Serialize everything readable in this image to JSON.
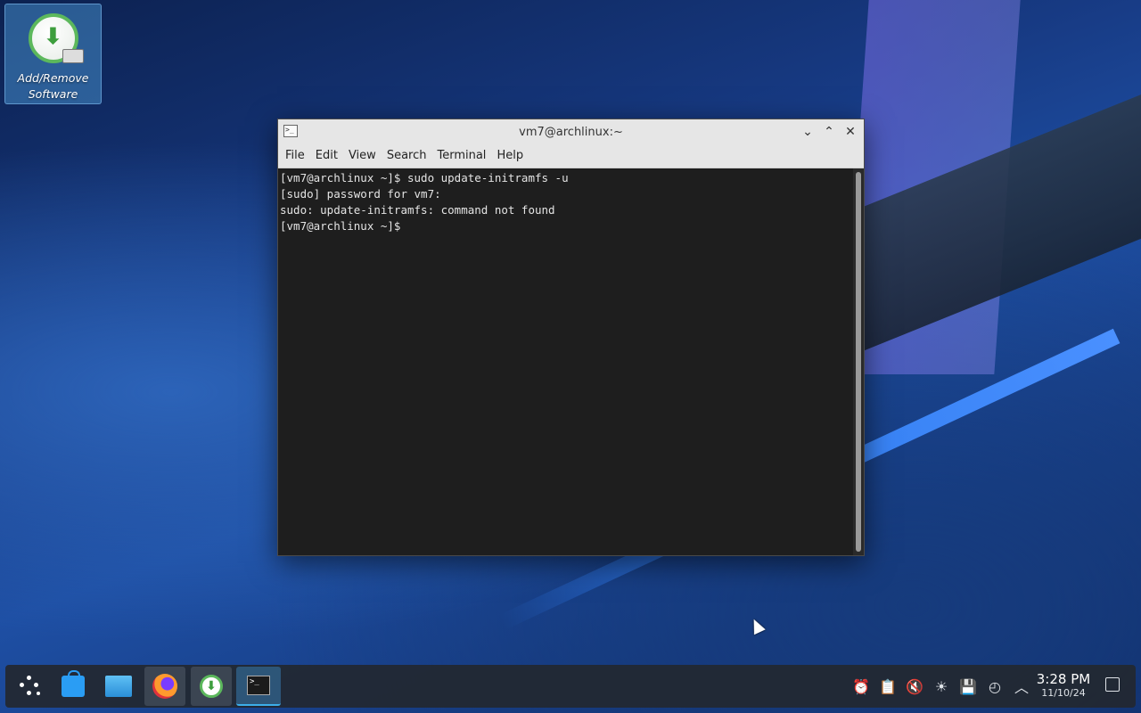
{
  "desktop": {
    "icons": [
      {
        "label_line1": "Add/Remove",
        "label_line2": "Software",
        "icon": "package-install-icon"
      }
    ]
  },
  "window": {
    "title": "vm7@archlinux:~",
    "app_icon": "terminal-icon",
    "controls": {
      "minimize": "minimize-icon",
      "maximize": "maximize-icon",
      "close": "close-icon"
    },
    "menu": [
      "File",
      "Edit",
      "View",
      "Search",
      "Terminal",
      "Help"
    ],
    "terminal_lines": [
      "[vm7@archlinux ~]$ sudo update-initramfs -u",
      "[sudo] password for vm7:",
      "sudo: update-initramfs: command not found",
      "[vm7@archlinux ~]$ "
    ]
  },
  "taskbar": {
    "launchers": [
      {
        "name": "application-launcher",
        "icon": "launcher-icon"
      },
      {
        "name": "discover",
        "icon": "store-icon"
      },
      {
        "name": "file-manager",
        "icon": "folder-icon"
      },
      {
        "name": "firefox",
        "icon": "firefox-icon"
      },
      {
        "name": "software-installer",
        "icon": "download-icon"
      },
      {
        "name": "konsole",
        "icon": "terminal-icon"
      }
    ],
    "tray": [
      "notifications-icon",
      "clipboard-icon",
      "volume-muted-icon",
      "brightness-icon",
      "save-icon",
      "update-icon",
      "expand-tray-icon"
    ],
    "clock": {
      "time": "3:28 PM",
      "date": "11/10/24"
    },
    "show_desktop": "show-desktop-icon"
  }
}
